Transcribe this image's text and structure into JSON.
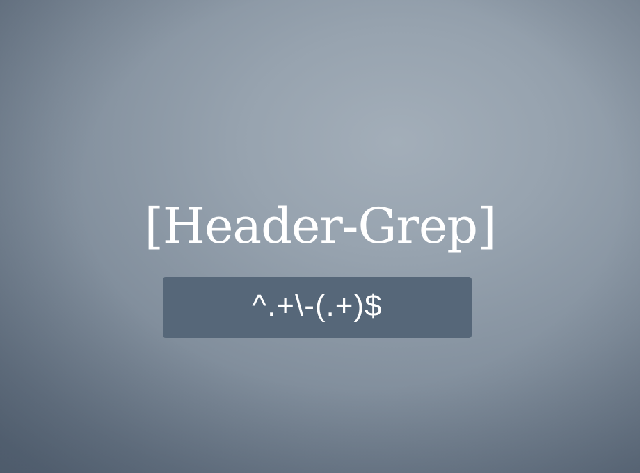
{
  "title": "[Header-Grep]",
  "regex": "^.+\\-(.+)$",
  "colors": {
    "background_center": "#a3aeb9",
    "background_edge": "#5b6a7b",
    "regex_box": "#566779",
    "text": "#ffffff"
  }
}
